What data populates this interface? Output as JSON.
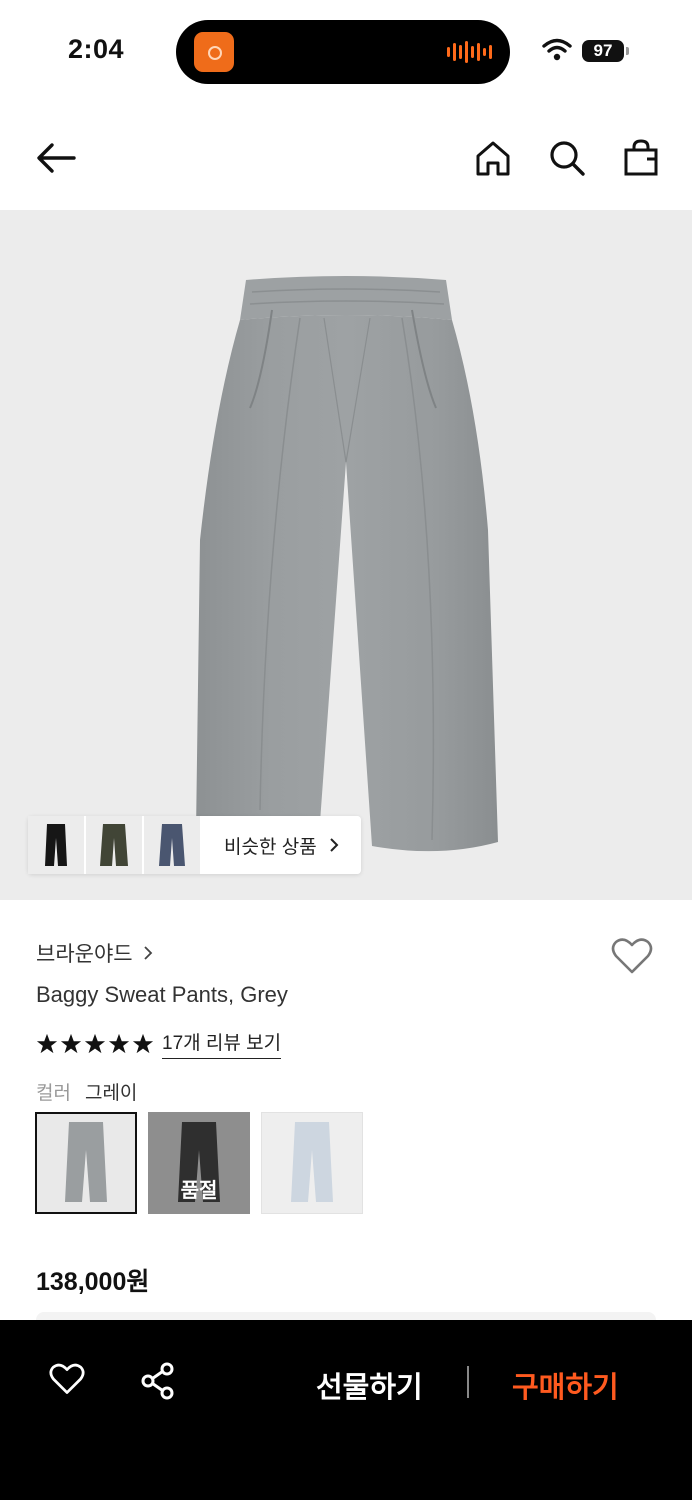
{
  "status_bar": {
    "time": "2:04",
    "battery": "97"
  },
  "header": {
    "back_icon": "arrow-left-icon",
    "home_icon": "home-icon",
    "search_icon": "search-icon",
    "bag_icon": "shopping-bag-icon"
  },
  "gallery": {
    "similar_label": "비슷한 상품"
  },
  "product": {
    "brand": "브라운야드",
    "name": "Baggy Sweat Pants, Grey",
    "review_link": "17개 리뷰 보기",
    "rating": 5,
    "color_label": "컬러",
    "color_value": "그레이",
    "soldout_label": "품절",
    "price": "138,000원"
  },
  "bottom_bar": {
    "gift_label": "선물하기",
    "buy_label": "구매하기",
    "buy_color": "#ff5a1f"
  }
}
